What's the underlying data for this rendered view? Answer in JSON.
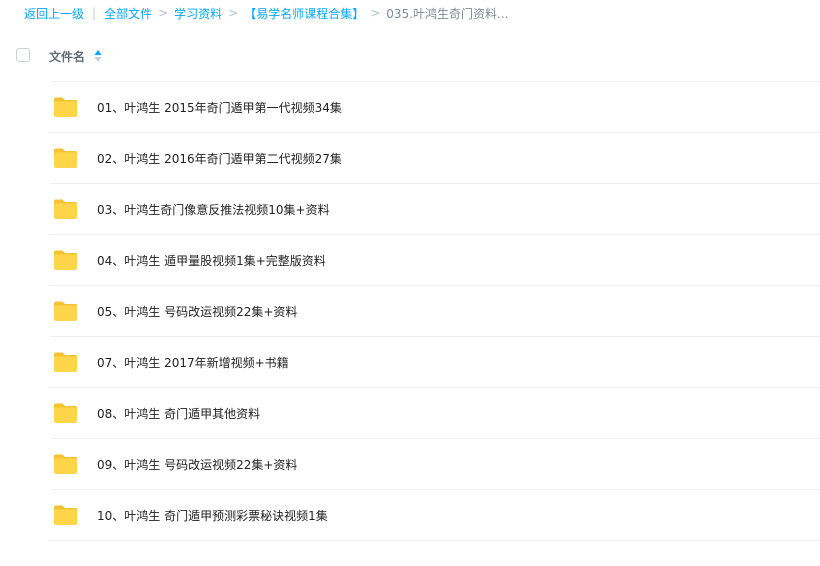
{
  "breadcrumb": {
    "back": "返回上一级",
    "items": [
      "全部文件",
      "学习资料",
      "【易学名师课程合集】"
    ],
    "current": "035.叶鸿生奇门资料..."
  },
  "list_header": {
    "name_label": "文件名",
    "sort_icon": "sort-icon"
  },
  "files": [
    {
      "name": "01、叶鸿生 2015年奇门遁甲第一代视频34集",
      "icon": "folder-icon"
    },
    {
      "name": "02、叶鸿生 2016年奇门遁甲第二代视频27集",
      "icon": "folder-icon"
    },
    {
      "name": "03、叶鸿生奇门像意反推法视频10集+资料",
      "icon": "folder-icon"
    },
    {
      "name": "04、叶鸿生 遁甲量股视频1集+完整版资料",
      "icon": "folder-icon"
    },
    {
      "name": "05、叶鸿生 号码改运视频22集+资料",
      "icon": "folder-icon"
    },
    {
      "name": "07、叶鸿生 2017年新增视频+书籍",
      "icon": "folder-icon"
    },
    {
      "name": "08、叶鸿生 奇门遁甲其他资料",
      "icon": "folder-icon"
    },
    {
      "name": "09、叶鸿生 号码改运视频22集+资料",
      "icon": "folder-icon"
    },
    {
      "name": "10、叶鸿生 奇门遁甲预测彩票秘诀视频1集",
      "icon": "folder-icon"
    }
  ],
  "colors": {
    "link": "#06a7ff",
    "folder": "#ffd54a",
    "folder_tab": "#f5c234",
    "divider": "#eef0f3"
  }
}
